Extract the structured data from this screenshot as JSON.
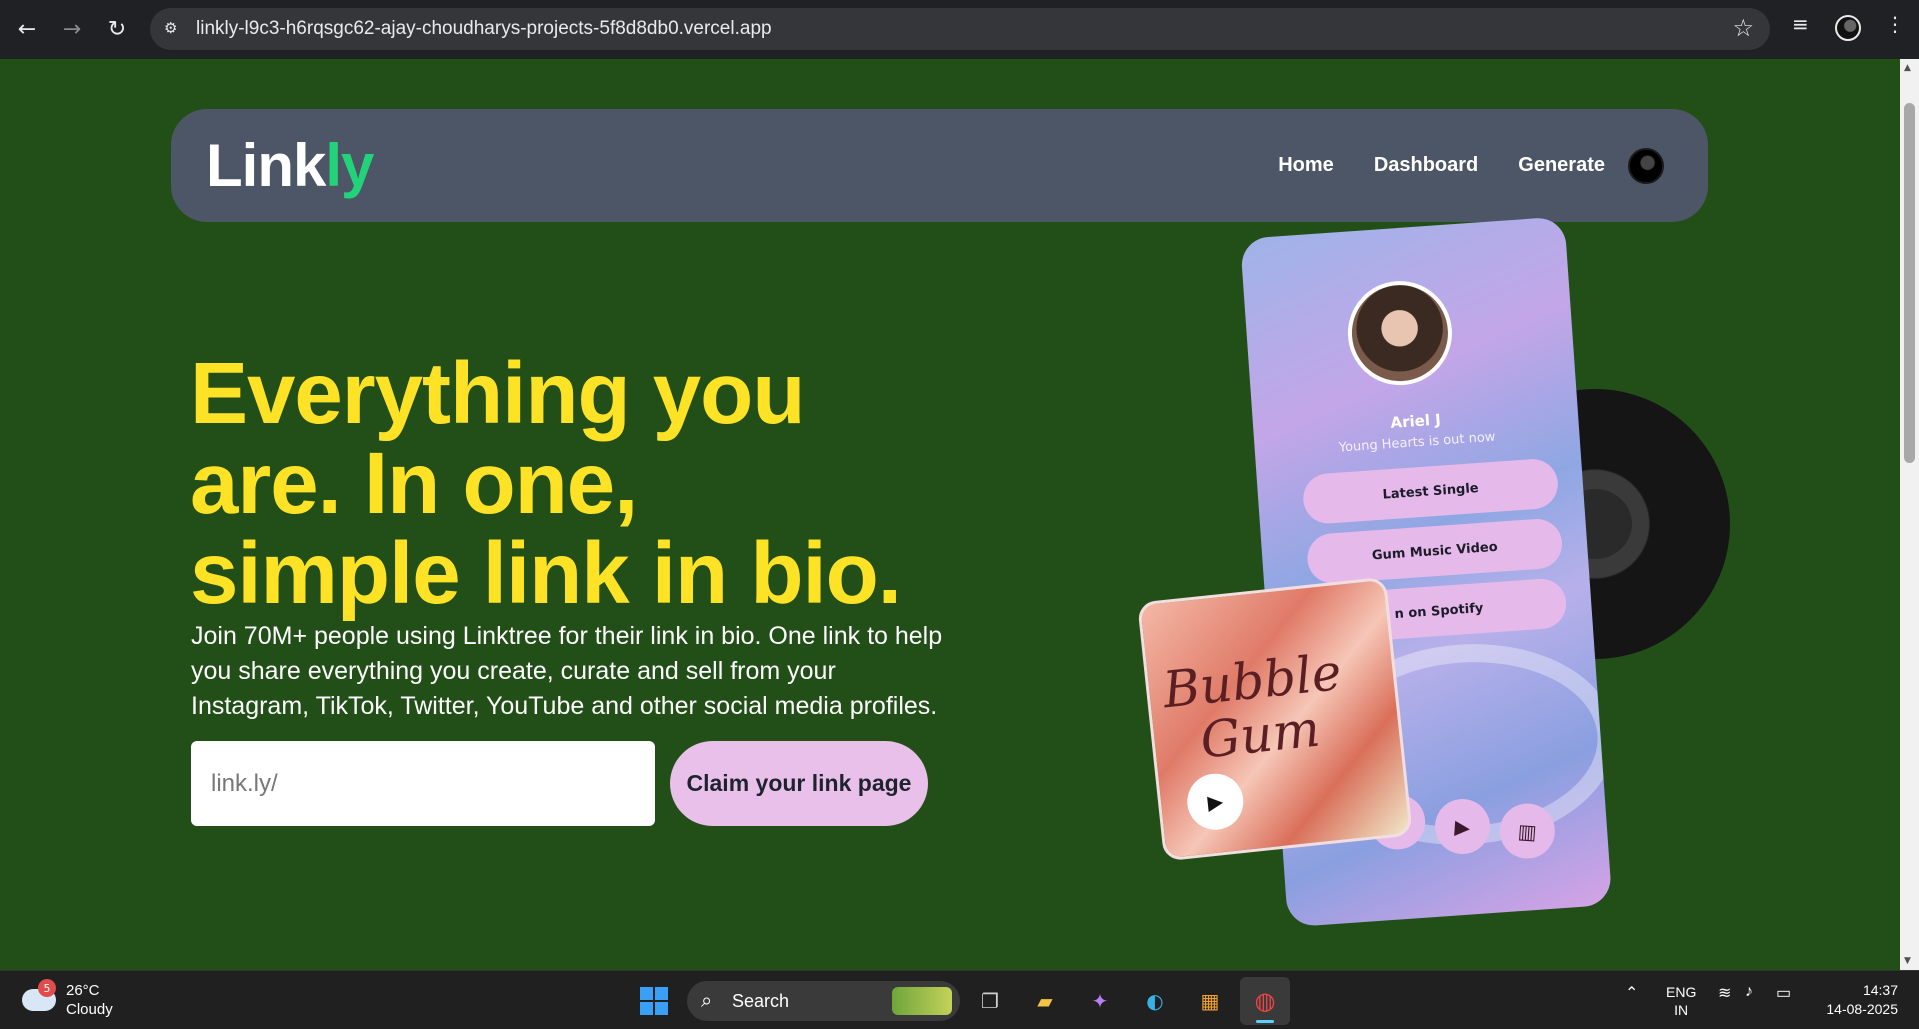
{
  "browser": {
    "url": "linkly-l9c3-h6rqsgc62-ajay-choudharys-projects-5f8d8db0.vercel.app"
  },
  "navbar": {
    "logo_main": "Link",
    "logo_accent": "ly",
    "links": [
      "Home",
      "Dashboard",
      "Generate"
    ]
  },
  "hero": {
    "title_line1": "Everything you",
    "title_line2": "are. In one,",
    "title_line3": "simple link in bio.",
    "subtitle": "Join 70M+ people using Linktree for their link in bio. One link to help you share everything you create, curate and sell from your Instagram, TikTok, Twitter, YouTube and other social media profiles.",
    "input_placeholder": "link.ly/",
    "cta": "Claim your link page"
  },
  "illustration": {
    "profile_name": "Ariel J",
    "profile_tagline": "Young Hearts is out now",
    "buttons": [
      "Latest Single",
      "Gum Music Video",
      "n on Spotify"
    ],
    "album_text_line1": "Bubble",
    "album_text_line2": "Gum"
  },
  "taskbar": {
    "weather_temp": "26°C",
    "weather_desc": "Cloudy",
    "weather_badge": "5",
    "search_label": "Search",
    "language_line1": "ENG",
    "language_line2": "IN",
    "time": "14:37",
    "date": "14-08-2025"
  }
}
